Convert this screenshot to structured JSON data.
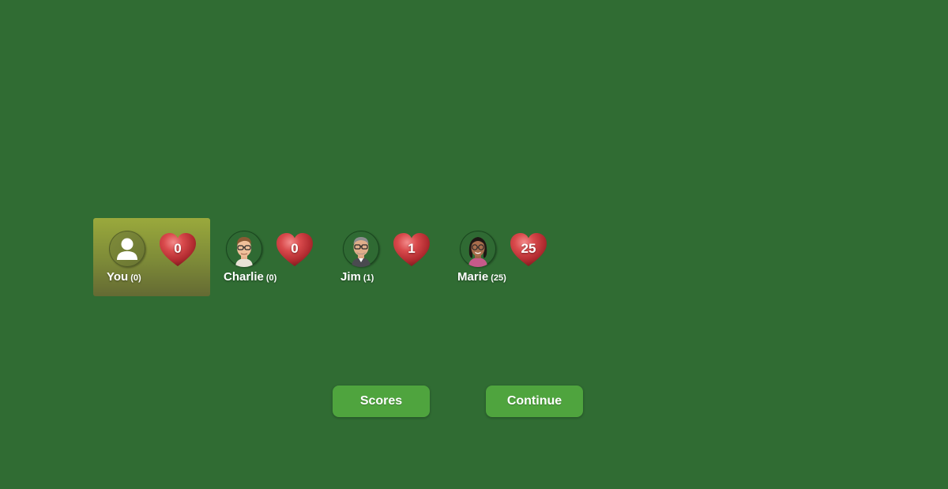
{
  "players": [
    {
      "name": "You",
      "score": "(0)",
      "hearts": "0",
      "avatar": "user-silhouette-icon",
      "active": true
    },
    {
      "name": "Charlie",
      "score": "(0)",
      "hearts": "0",
      "avatar": "charlie-avatar",
      "active": false
    },
    {
      "name": "Jim",
      "score": "(1)",
      "hearts": "1",
      "avatar": "jim-avatar",
      "active": false
    },
    {
      "name": "Marie",
      "score": "(25)",
      "hearts": "25",
      "avatar": "marie-avatar",
      "active": false
    }
  ],
  "buttons": {
    "scores_label": "Scores",
    "continue_label": "Continue"
  },
  "colors": {
    "table_felt": "#306c33",
    "active_highlight": "#8e9c3b",
    "button_green": "#4fa43e",
    "heart_red": "#c23a3c"
  }
}
